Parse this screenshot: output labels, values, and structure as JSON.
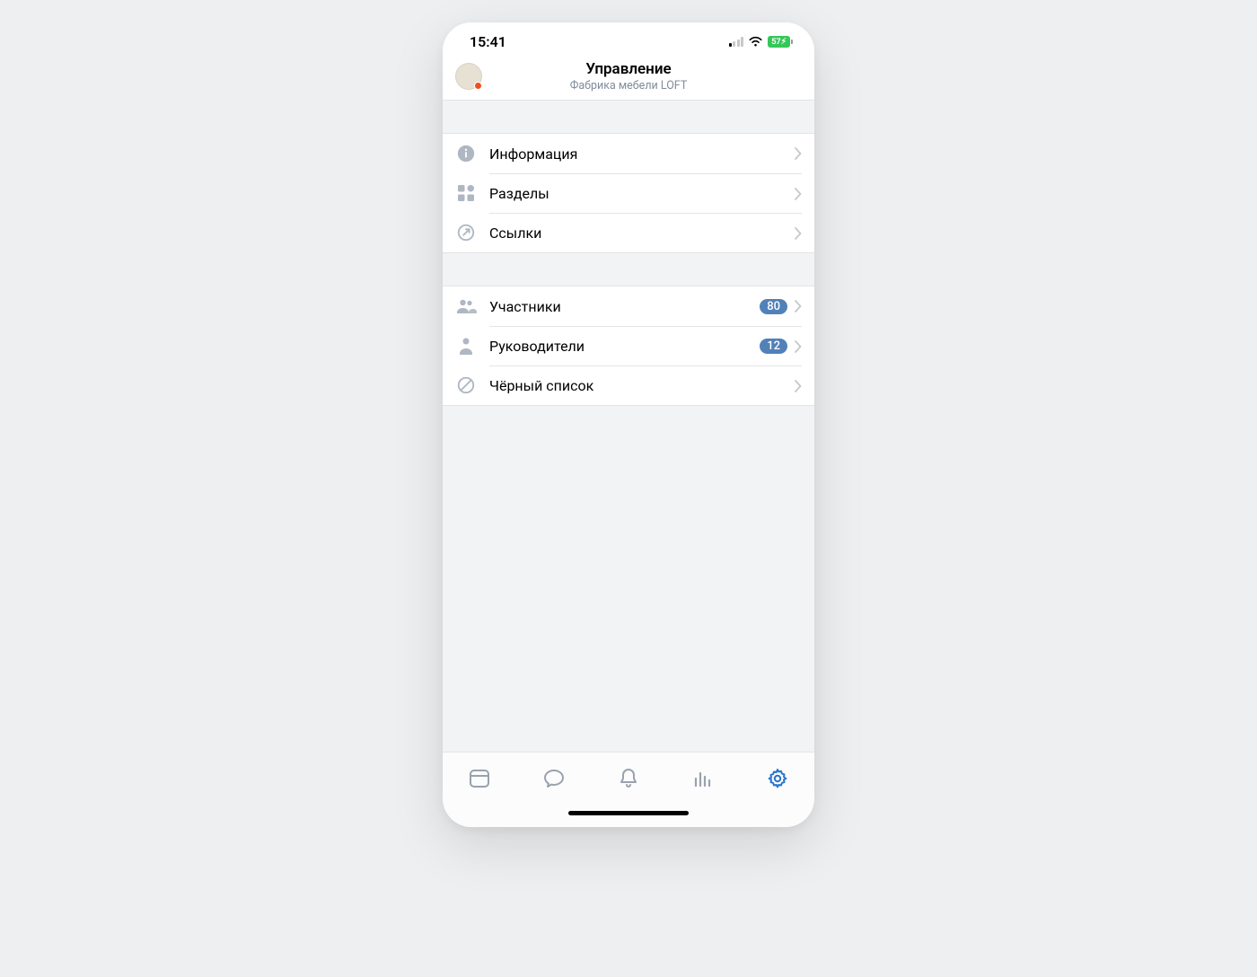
{
  "status": {
    "time": "15:41",
    "battery_text": "57"
  },
  "header": {
    "title": "Управление",
    "subtitle": "Фабрика мебели LOFT"
  },
  "groups": [
    {
      "rows": [
        {
          "icon": "info-icon",
          "label": "Информация"
        },
        {
          "icon": "sections-icon",
          "label": "Разделы"
        },
        {
          "icon": "link-icon",
          "label": "Ссылки"
        }
      ]
    },
    {
      "rows": [
        {
          "icon": "members-icon",
          "label": "Участники",
          "badge": "80"
        },
        {
          "icon": "admin-icon",
          "label": "Руководители",
          "badge": "12"
        },
        {
          "icon": "blocklist-icon",
          "label": "Чёрный список"
        }
      ]
    }
  ],
  "tabs": [
    {
      "name": "browser",
      "active": false
    },
    {
      "name": "messages",
      "active": false
    },
    {
      "name": "notifications",
      "active": false
    },
    {
      "name": "stats",
      "active": false
    },
    {
      "name": "settings",
      "active": true
    }
  ]
}
